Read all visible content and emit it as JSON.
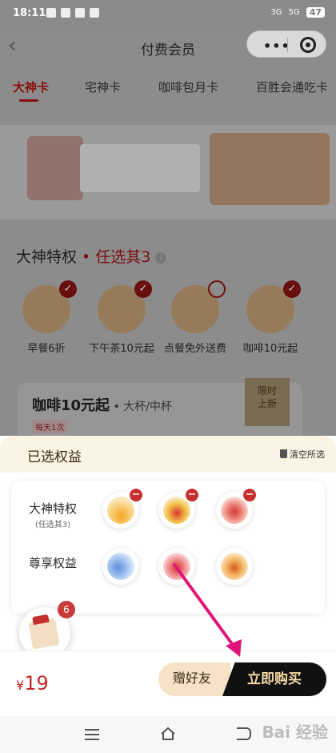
{
  "status_bar": {
    "time": "18:11",
    "battery": "47",
    "signal_a": "3G",
    "signal_b": "5G"
  },
  "header": {
    "title": "付费会员",
    "back_glyph": "‹",
    "more_glyph": "•••"
  },
  "tabs": [
    {
      "label": "大神卡",
      "active": true
    },
    {
      "label": "宅神卡",
      "active": false
    },
    {
      "label": "咖啡包月卡",
      "active": false
    },
    {
      "label": "百胜会通吃卡",
      "active": false
    }
  ],
  "privileges": {
    "title": "大神特权",
    "subtitle": " • 任选其3",
    "info": "i",
    "items": [
      {
        "label": "早餐6折",
        "icon": "breakfast-sun-icon",
        "checked": true
      },
      {
        "label": "下午茶10元起",
        "icon": "afternoon-tea-icon",
        "checked": true
      },
      {
        "label": "点餐免外送费",
        "icon": "delivery-scooter-icon",
        "checked": false
      },
      {
        "label": "咖啡10元起",
        "icon": "coffee-cup-icon",
        "checked": true
      }
    ]
  },
  "coffee_card": {
    "name": "咖啡10元起",
    "spec": " • 大杯/中杯",
    "daily": "每天1次",
    "ribbon_line1": "限时",
    "ribbon_line2": "上新"
  },
  "sheet": {
    "title": "已选权益",
    "clear": "清空所选",
    "row1_label": "大神特权",
    "row1_sub": "(任选其3)",
    "row2_label": "尊享权益",
    "cart_count": "6",
    "price_currency": "¥",
    "price_value": "19",
    "gift_button": "赠好友",
    "buy_button": "立即购买"
  },
  "colors": {
    "accent_red": "#c62828",
    "cream": "#fbf4e4",
    "buy_gold": "#f3d9a5"
  },
  "watermark": "Bai 经验"
}
